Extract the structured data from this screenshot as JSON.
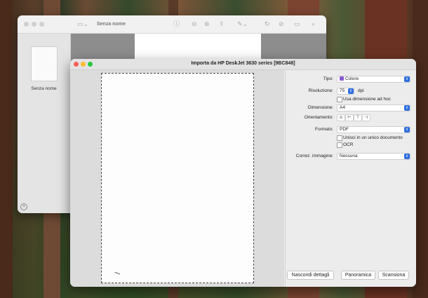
{
  "preview_window": {
    "document_title": "Senza nome",
    "thumbnail_label": "Senza nome"
  },
  "dialog": {
    "title": "Importa da HP DeskJet 3630 series [9BC848]",
    "tipo": {
      "label": "Tipo:",
      "value": "Colore"
    },
    "risoluzione": {
      "label": "Risoluzione:",
      "value": "75",
      "unit": "dpi"
    },
    "custom_size": {
      "label": "Usa dimensione ad hoc",
      "checked": false
    },
    "dimensione": {
      "label": "Dimensione:",
      "value": "A4"
    },
    "orientamento": {
      "label": "Orientamento:"
    },
    "formato": {
      "label": "Formato:",
      "value": "PDF"
    },
    "merge": {
      "label": "Unisci in un unico documento",
      "checked": false
    },
    "ocr": {
      "label": "OCR",
      "checked": false
    },
    "correzione": {
      "label": "Correz. immagine:",
      "value": "Nessuna"
    },
    "buttons": {
      "hide_details": "Nascondi dettagli",
      "overview": "Panoramica",
      "scan": "Scansiona"
    }
  },
  "colors": {
    "accent": "#2f6fde",
    "close": "#fe5f57",
    "minimize": "#febc2e",
    "zoom": "#28c840"
  }
}
